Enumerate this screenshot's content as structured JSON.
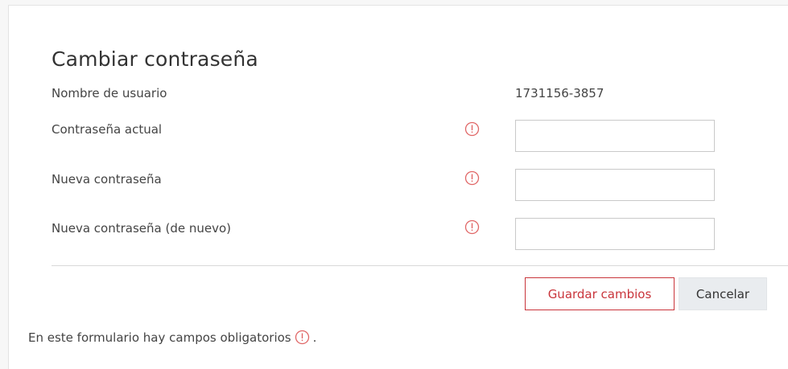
{
  "form": {
    "title": "Cambiar contraseña",
    "username_label": "Nombre de usuario",
    "username_value": "1731156-3857",
    "current_password_label": "Contraseña actual",
    "new_password_label": "Nueva contraseña",
    "new_password_again_label": "Nueva contraseña (de nuevo)",
    "current_password_value": "",
    "new_password_value": "",
    "new_password_again_value": "",
    "required_icon": "exclamation-circle-icon"
  },
  "actions": {
    "save_label": "Guardar cambios",
    "cancel_label": "Cancelar"
  },
  "footer": {
    "required_note": "En este formulario hay campos obligatorios",
    "required_note_suffix": "."
  },
  "colors": {
    "required": "#e06666",
    "save_border": "#c9353b",
    "cancel_bg": "#e9ecef"
  }
}
